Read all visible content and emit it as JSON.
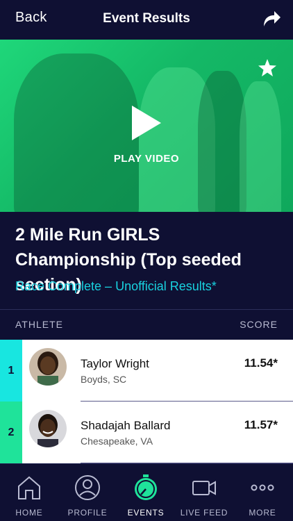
{
  "header": {
    "back_label": "Back",
    "title": "Event Results",
    "share_icon": "share-icon"
  },
  "video": {
    "play_label": "PLAY VIDEO",
    "favorite_icon": "star-icon",
    "play_icon": "play-icon",
    "tint_color": "#1fd77a"
  },
  "event": {
    "title": "2 Mile Run GIRLS Championship (Top seeded section)",
    "status": "Race Complete – Unofficial Results*",
    "status_color": "#19d2e0"
  },
  "columns": {
    "athlete": "ATHLETE",
    "score": "SCORE"
  },
  "results": [
    {
      "rank": "1",
      "name": "Taylor Wright",
      "location": "Boyds, SC",
      "score": "11.54*",
      "rank_color": "#18e6e0"
    },
    {
      "rank": "2",
      "name": "Shadajah Ballard",
      "location": "Chesapeake, VA",
      "score": "11.57*",
      "rank_color": "#1fe39a"
    }
  ],
  "tabs": [
    {
      "label": "HOME",
      "icon": "home-icon"
    },
    {
      "label": "PROFILE",
      "icon": "profile-icon"
    },
    {
      "label": "EVENTS",
      "icon": "stopwatch-icon",
      "active": true
    },
    {
      "label": "LIVE FEED",
      "icon": "video-camera-icon"
    },
    {
      "label": "MORE",
      "icon": "more-icon"
    }
  ],
  "colors": {
    "background": "#0f1033",
    "accent_green": "#1fe39a"
  }
}
